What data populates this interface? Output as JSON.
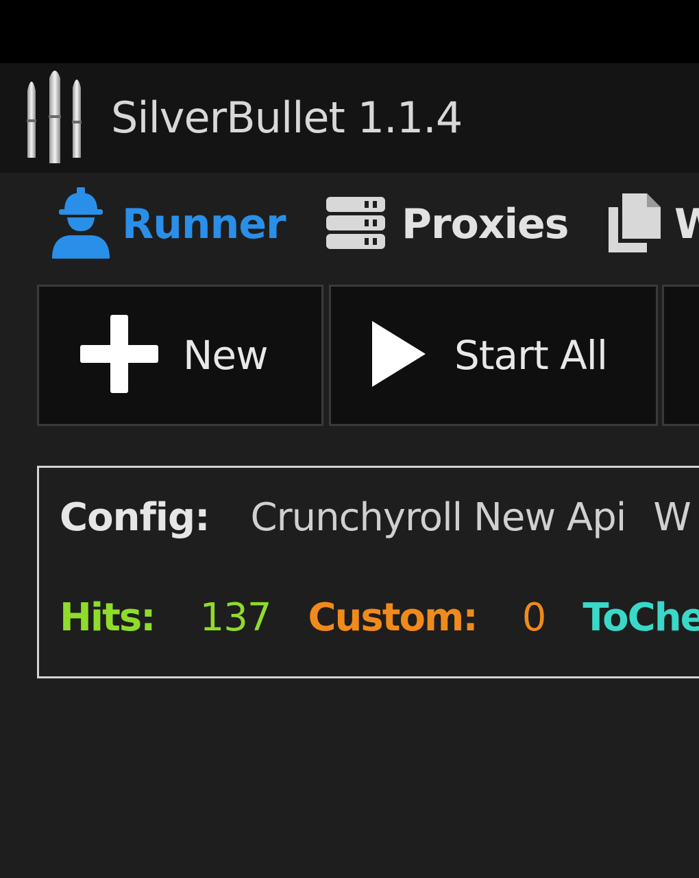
{
  "app": {
    "title": "SilverBullet 1.1.4"
  },
  "nav": {
    "items": [
      {
        "label": "Runner",
        "icon": "worker-icon",
        "active": true
      },
      {
        "label": "Proxies",
        "icon": "server-icon",
        "active": false
      },
      {
        "label": "W",
        "icon": "documents-icon",
        "active": false
      }
    ]
  },
  "toolbar": {
    "new_label": "New",
    "new_icon": "plus-icon",
    "start_all_label": "Start All",
    "start_all_icon": "play-icon"
  },
  "runner": {
    "config_label": "Config:",
    "config_value": "Crunchyroll New Api",
    "config_next": "W",
    "hits_label": "Hits:",
    "hits_value": "137",
    "custom_label": "Custom:",
    "custom_value": "0",
    "tocheck_label": "ToChe"
  },
  "colors": {
    "accent_active": "#2a8fe8",
    "hits": "#8fdc2a",
    "custom": "#f08a1c",
    "tocheck": "#3ad8c8",
    "background": "#1e1e1e",
    "titlebar": "#141414"
  }
}
